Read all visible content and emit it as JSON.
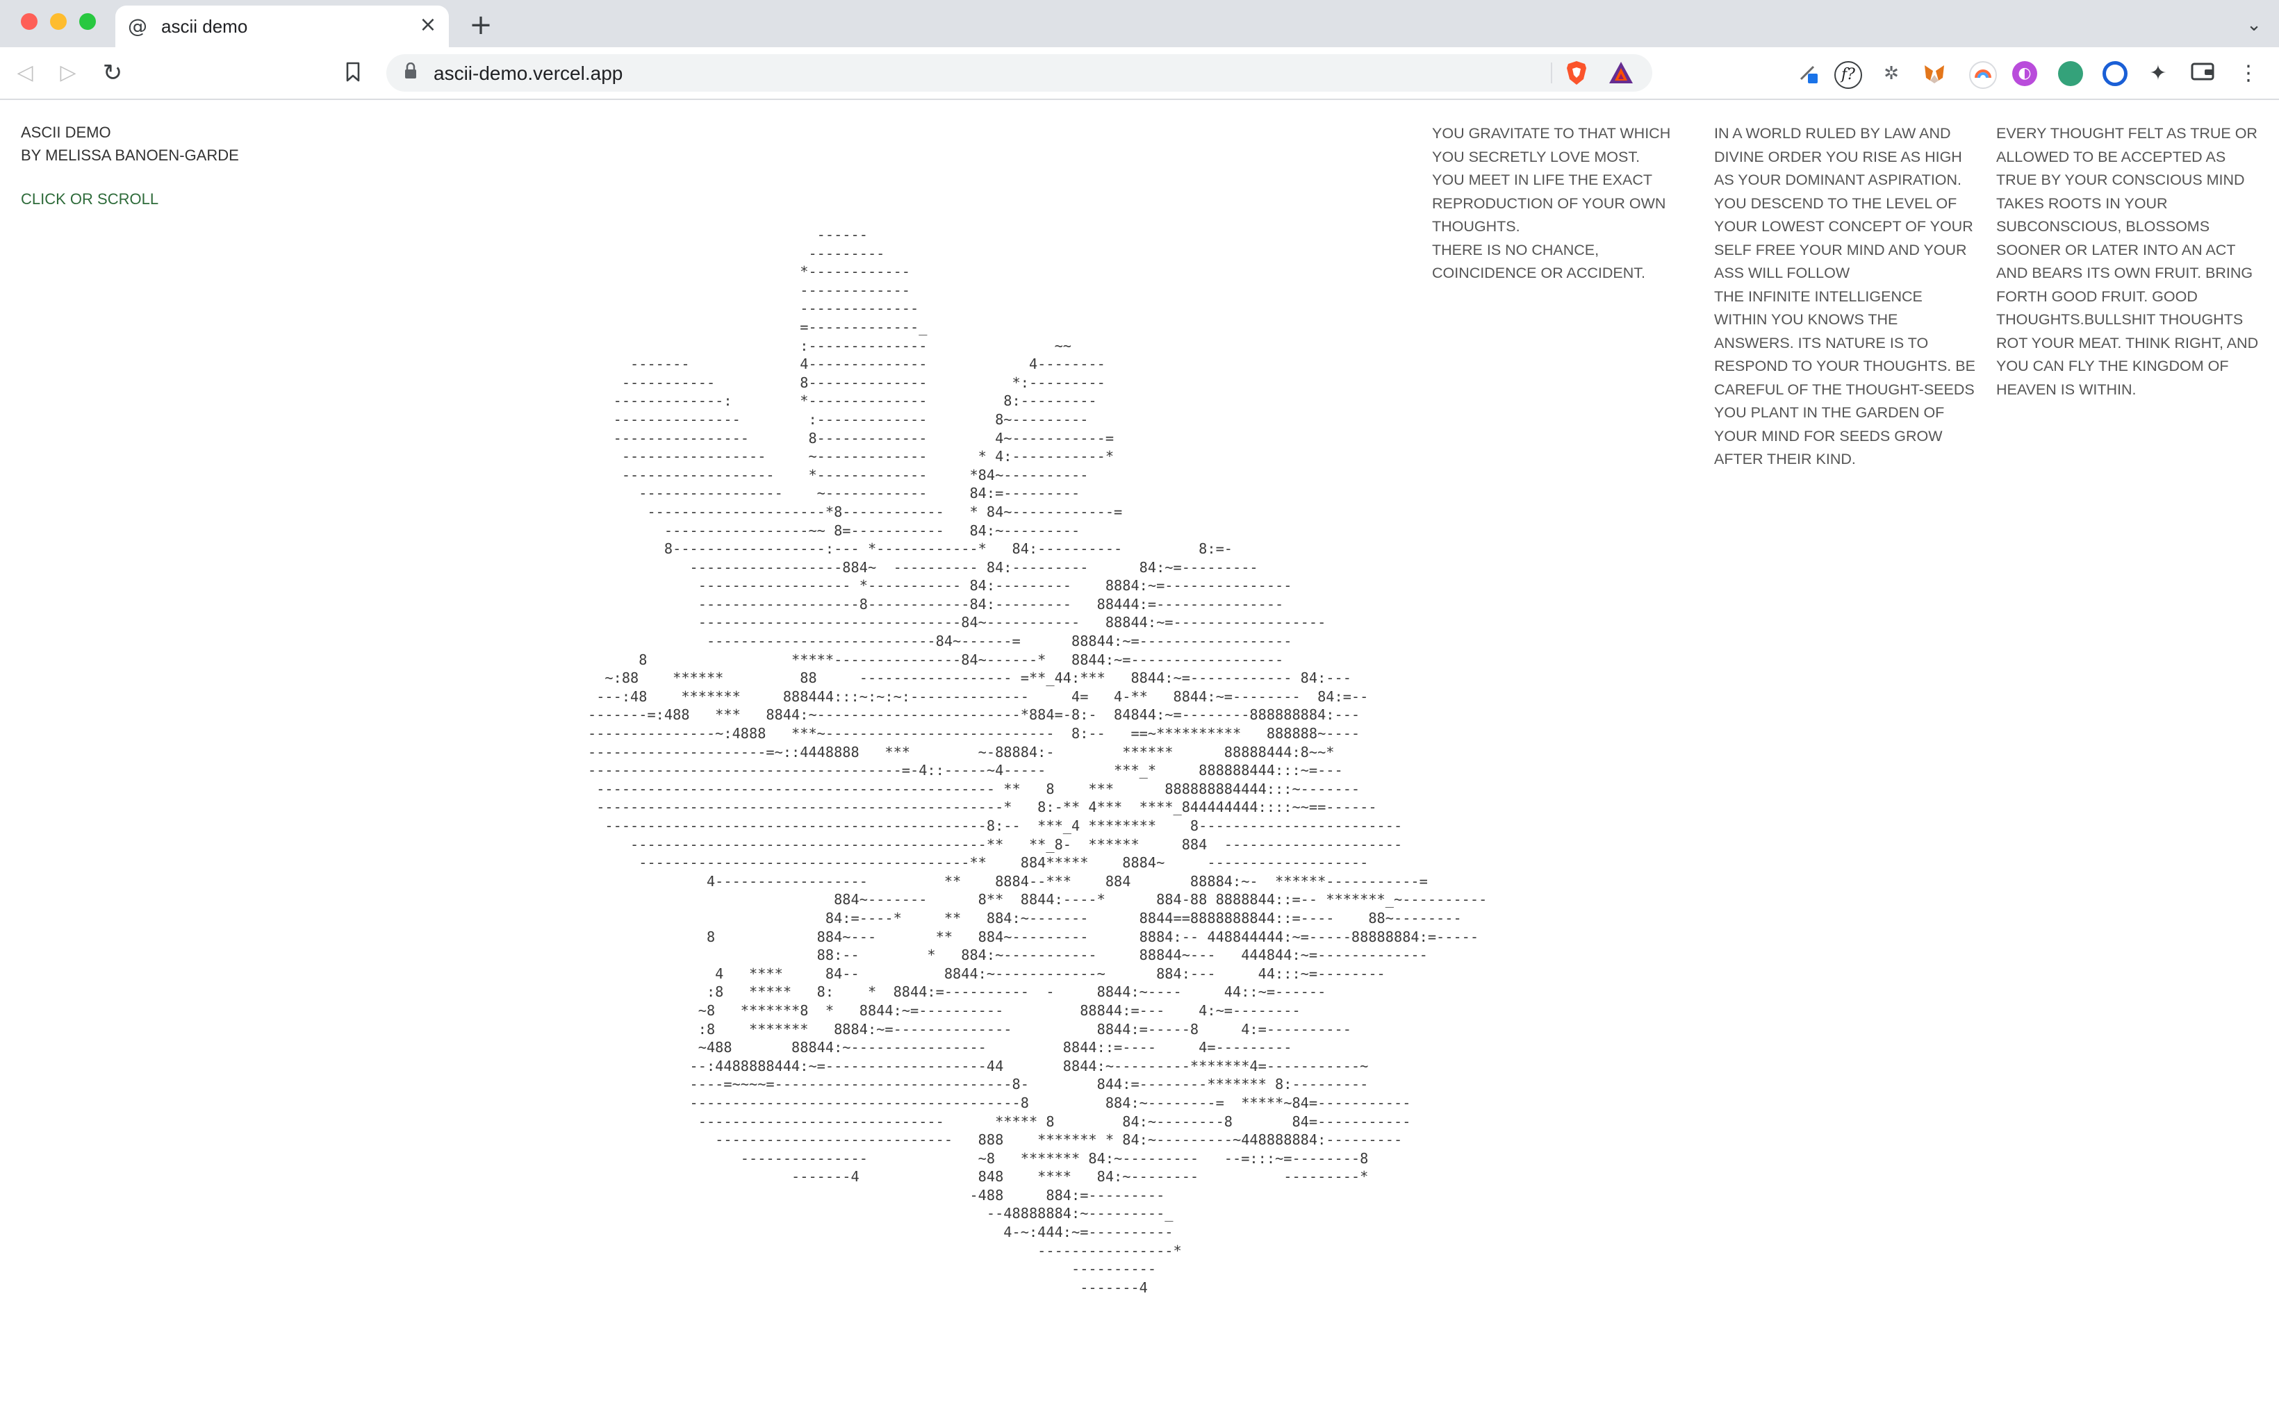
{
  "browser": {
    "tab_title": "ascii demo",
    "tab_favicon": "@",
    "url": "ascii-demo.vercel.app",
    "icons": {
      "back": "arrow-left",
      "forward": "arrow-right",
      "reload": "reload",
      "bookmark": "bookmark",
      "lock": "lock",
      "close_tab": "close",
      "new_tab": "plus",
      "tab_search": "chevron-down"
    },
    "extensions": [
      "brave-shields",
      "brave-rewards",
      "person",
      "fonts",
      "bug",
      "metamask",
      "rainbow",
      "pink-circle",
      "green-circle",
      "blue-ring",
      "puzzle",
      "wallet",
      "menu"
    ]
  },
  "page": {
    "title": "ASCII DEMO",
    "author": "BY MELISSA BANOEN-GARDE",
    "link": "CLICK OR SCROLL",
    "quotes": [
      "YOU GRAVITATE TO THAT WHICH YOU SECRETLY LOVE MOST.\nYOU MEET IN LIFE THE EXACT REPRODUCTION OF YOUR OWN THOUGHTS.\nTHERE IS NO CHANCE, COINCIDENCE OR ACCIDENT.",
      "IN A WORLD RULED BY LAW AND DIVINE ORDER YOU RISE AS HIGH AS YOUR DOMINANT ASPIRATION. YOU DESCEND TO THE LEVEL OF YOUR LOWEST CONCEPT OF YOUR SELF FREE YOUR MIND AND YOUR ASS WILL FOLLOW\nTHE INFINITE INTELLIGENCE WITHIN YOU KNOWS THE ANSWERS. ITS NATURE IS TO RESPOND TO YOUR THOUGHTS. BE CAREFUL OF THE THOUGHT-SEEDS YOU PLANT IN THE GARDEN OF YOUR MIND FOR SEEDS GROW AFTER THEIR KIND.",
      "EVERY THOUGHT FELT AS TRUE OR ALLOWED TO BE ACCEPTED AS TRUE BY YOUR CONSCIOUS MIND TAKES ROOTS IN YOUR SUBCONSCIOUS, BLOSSOMS SOONER OR LATER INTO AN ACT AND BEARS ITS OWN FRUIT. BRING FORTH GOOD FRUIT. GOOD THOUGHTS.BULLSHIT THOUGHTS ROT YOUR MEAT. THINK RIGHT, AND YOU CAN FLY THE KINGDOM OF HEAVEN IS WITHIN."
    ],
    "ascii_art": [
      "                           ------",
      "                          ---------",
      "                         *------------",
      "                         -------------",
      "                         --------------",
      "                         =-------------_",
      "                         :--------------               ~~",
      "     -------             4--------------            4--------",
      "    -----------          8--------------          *:---------",
      "   -------------:        *--------------         8:---------",
      "   ---------------        :-------------        8~---------",
      "   ----------------       8-------------        4~-----------=",
      "    -----------------     ~-------------      * 4:-----------*",
      "    ------------------    *-------------     *84~----------",
      "      -----------------    ~------------     84:=---------",
      "       ---------------------*8------------   * 84~------------=",
      "         -----------------~~ 8=-----------   84:~---------",
      "         8------------------:--- *------------*   84:----------         8:=-",
      "            ------------------884~  ---------- 84:---------      84:~=---------",
      "             ------------------ *----------- 84:---------    8884:~=---------------",
      "             -------------------8------------84:---------   88444:=---------------",
      "             -------------------------------84~-----------   88844:~=------------------",
      "              ---------------------------84~------=      88844:~=------------------",
      "      8                 *****---------------84~------*   8844:~=------------------",
      "  ~:88    ******         88     ------------------ =**_44:***   8844:~=------------ 84:---",
      " ---:48    *******     888444:::~:~:~:--------------     4=   4-**   8844:~=--------  84:=--",
      "-------=:488   ***   8844:~------------------------*884=-8:-  84844:~=--------888888884:---",
      "---------------~:4888   ***~---------------------------  8:--   ==~**********   888888~----",
      "---------------------=~::4448888   ***        ~-88884:-        ******      88888444:8~~*",
      "-------------------------------------=-4::-----~4-----        ***_*     888888444:::~=---",
      " ----------------------------------------------- **   8    ***      888888884444:::~-------",
      " ------------------------------------------------*   8:-** 4***  ****_844444444::::~~==------",
      "  ---------------------------------------------8:--  ***_4 ********    8------------------------",
      "     ------------------------------------------**   **_8-  ******     884  ---------------------",
      "      ---------------------------------------**    884*****    8884~     -------------------",
      "              4------------------         **    8884--***    884       88884:~-  ******-----------=",
      "                             884~-------      8**  8844:----*      884-88 8888844::=-- *******_~----------",
      "                            84:=----*     **   884:~-------      8844==8888888844::=----    88~--------",
      "              8            884~---       **   884~---------      8884:-- 448844444:~=-----88888884:=-----",
      "                           88:--        *   884:~-----------     88844~---   444844:~=-------------",
      "               4   ****     84--          8844:~------------~      884:---     44:::~=--------",
      "              :8   *****   8:    *  8844:=----------  -     8844:~----     44::~=------",
      "             ~8   *******8  *   8844:~=----------         88844:=---    4:~=--------",
      "             :8    *******   8884:~=--------------          8844:=-----8     4:=----------",
      "             ~488       88844:~----------------         8844::=----     4=---------",
      "            --:4488888444:~=-------------------44       8844:~---------*******4=-----------~",
      "            ----=~~~~=----------------------------8-        844:=--------******* 8:---------",
      "            ---------------------------------------8         884:~--------=  *****~84=-----------",
      "             -----------------------------      ***** 8        84:~--------8       84=-----------",
      "               ----------------------------   888    ******* * 84:~---------~448888884:---------",
      "                  ---------------             ~8   ******* 84:~---------   --=:::~=--------8",
      "                        -------4              848    ****   84:~--------          ---------*",
      "                                             -488     884:=---------",
      "                                               --48888884:~---------_",
      "                                                 4-~:444:~=----------",
      "                                                     ----------------*",
      "                                                         ----------",
      "                                                          -------4"
    ]
  }
}
